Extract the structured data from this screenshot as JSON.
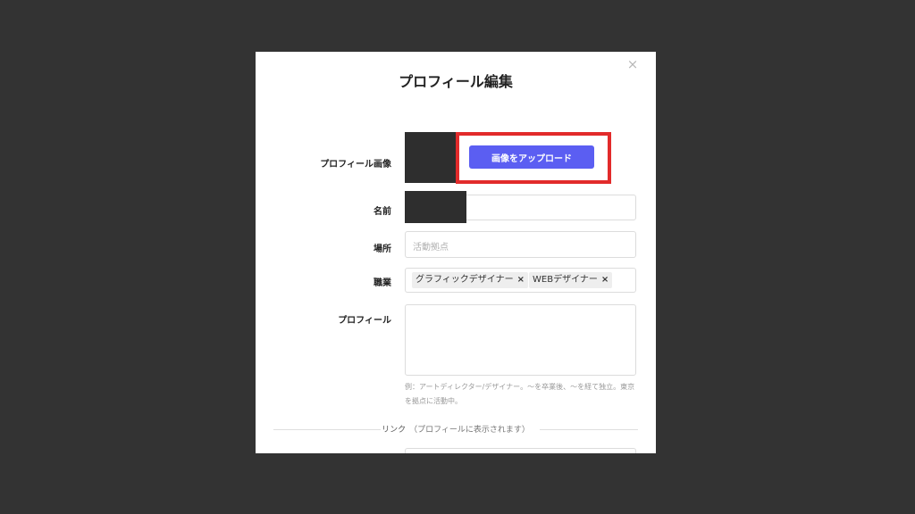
{
  "modal": {
    "title": "プロフィール編集",
    "close_icon": "×"
  },
  "fields": {
    "image": {
      "label": "プロフィール画像",
      "upload_button": "画像をアップロード"
    },
    "name": {
      "label": "名前",
      "value": ""
    },
    "location": {
      "label": "場所",
      "placeholder": "活動拠点"
    },
    "occupation": {
      "label": "職業",
      "tags": [
        {
          "text": "グラフィックデザイナー",
          "remove": "×"
        },
        {
          "text": "WEBデザイナー",
          "remove": "×"
        }
      ]
    },
    "profile": {
      "label": "プロフィール",
      "hint": "例：アートディレクター/デザイナー。〜を卒業後、〜を経て独立。東京を拠点に活動中。"
    }
  },
  "links": {
    "heading": "リンク",
    "sub": "（プロフィールに表示されます）"
  },
  "colors": {
    "backdrop": "#333333",
    "primary": "#5b5ef2",
    "highlight": "#e22b2b"
  }
}
